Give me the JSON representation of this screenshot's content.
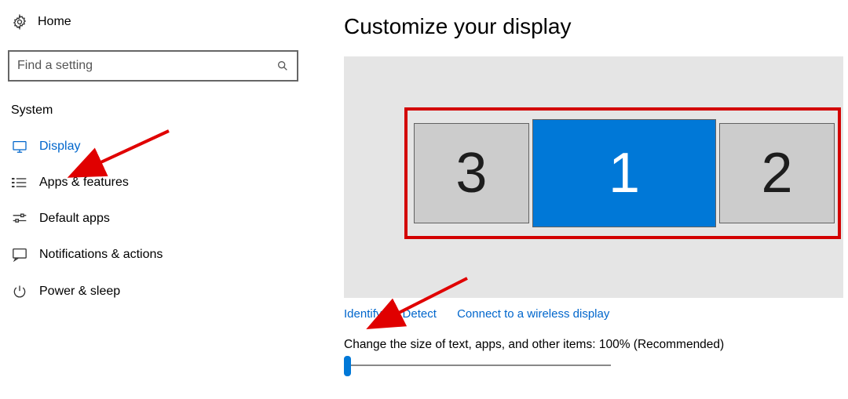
{
  "sidebar": {
    "home_label": "Home",
    "search_placeholder": "Find a setting",
    "section_label": "System",
    "items": [
      {
        "label": "Display",
        "active": true
      },
      {
        "label": "Apps & features",
        "active": false
      },
      {
        "label": "Default apps",
        "active": false
      },
      {
        "label": "Notifications & actions",
        "active": false
      },
      {
        "label": "Power & sleep",
        "active": false
      }
    ]
  },
  "main": {
    "title": "Customize your display",
    "monitors": [
      "3",
      "1",
      "2"
    ],
    "link_identify": "Identify",
    "link_detect": "Detect",
    "link_wireless": "Connect to a wireless display",
    "scale_label": "Change the size of text, apps, and other items: 100% (Recommended)"
  }
}
